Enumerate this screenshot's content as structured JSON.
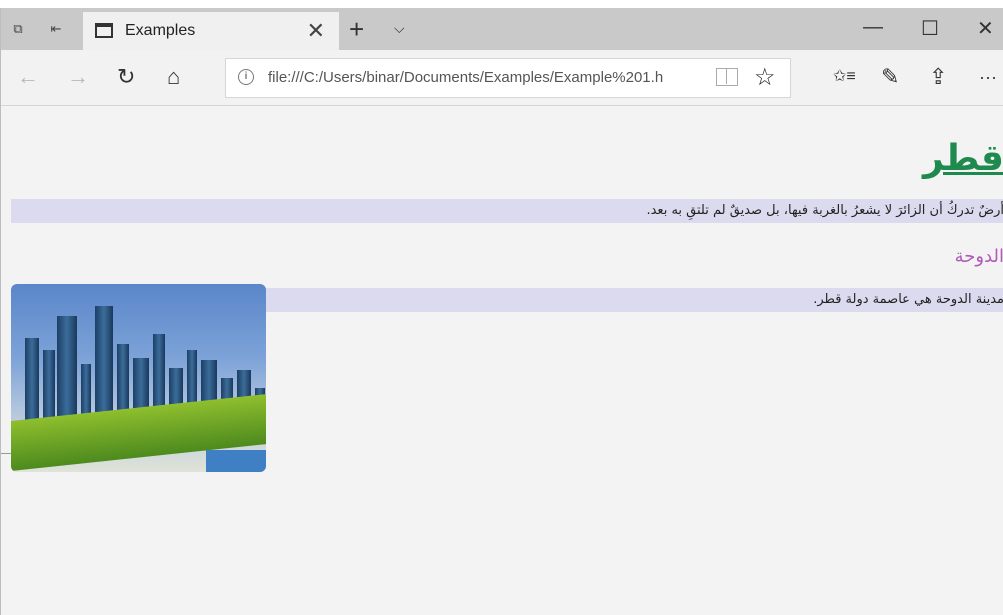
{
  "browser": {
    "tab": {
      "title": "Examples",
      "close": "✕"
    },
    "new_tab": "+",
    "tab_menu": "⌵",
    "window_controls": {
      "minimize": "—",
      "maximize": "☐",
      "close": "✕"
    },
    "nav": {
      "back": "←",
      "forward": "→",
      "refresh": "↻",
      "home": "⌂"
    },
    "url": "file:///C:/Users/binar/Documents/Examples/Example%201.h",
    "favorite": "☆",
    "toolbar": {
      "favorites": "✩≡",
      "notes": "✎",
      "share": "⇪",
      "more": "···"
    }
  },
  "page": {
    "title": "قطر",
    "paragraph1": "أرضٌ تدركُ أن الزائرَ لا يشعرُ بالغربة فيها، بل صديقٌ لم تلتقِ به بعد.",
    "subtitle": "الدوحة",
    "paragraph2": "مدينة الدوحة هي عاصمة دولة قطر."
  },
  "icons": [
    "tab-actions-icon",
    "set-aside-tabs-icon",
    "tab-page-icon",
    "info-icon",
    "reading-view-icon",
    "star-icon"
  ]
}
